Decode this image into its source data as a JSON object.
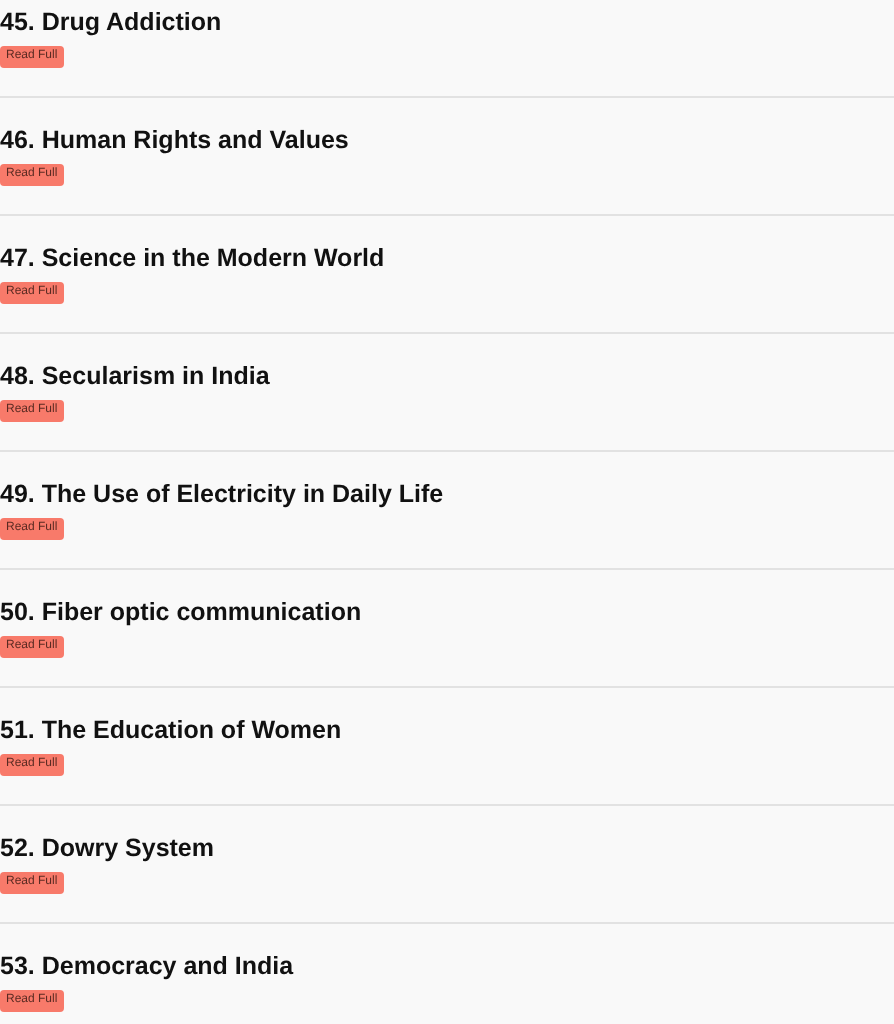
{
  "articles": [
    {
      "title": "45. Drug Addiction",
      "button": "Read Full"
    },
    {
      "title": "46. Human Rights and Values",
      "button": "Read Full"
    },
    {
      "title": "47. Science in the Modern World",
      "button": "Read Full"
    },
    {
      "title": "48. Secularism in India",
      "button": "Read Full"
    },
    {
      "title": "49. The Use of Electricity in Daily Life",
      "button": "Read Full"
    },
    {
      "title": "50. Fiber optic communication",
      "button": "Read Full"
    },
    {
      "title": "51. The Education of Women",
      "button": "Read Full"
    },
    {
      "title": "52. Dowry System",
      "button": "Read Full"
    },
    {
      "title": "53. Democracy and India",
      "button": "Read Full"
    }
  ]
}
